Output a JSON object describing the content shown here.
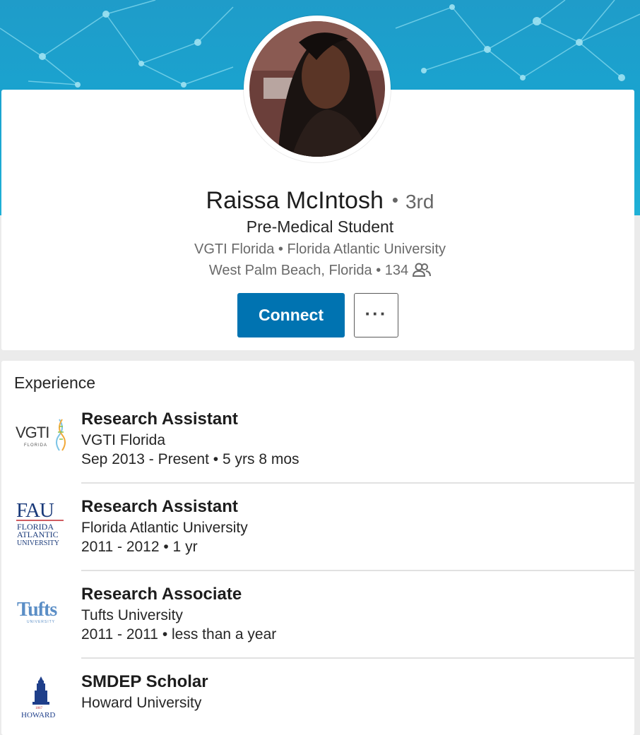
{
  "profile": {
    "name": "Raissa McIntosh",
    "degree": "3rd",
    "headline": "Pre-Medical Student",
    "organizations": "VGTI Florida • Florida Atlantic University",
    "location_connections": "West Palm Beach, Florida • 134",
    "connect_label": "Connect",
    "more_label": "···"
  },
  "experience": {
    "title": "Experience",
    "items": [
      {
        "role": "Research Assistant",
        "org": "VGTI Florida",
        "dates": "Sep 2013 - Present • 5 yrs 8 mos",
        "logo": "vgti-logo"
      },
      {
        "role": "Research Assistant",
        "org": "Florida Atlantic University",
        "dates": "2011 - 2012 • 1 yr",
        "logo": "fau-logo"
      },
      {
        "role": "Research Associate",
        "org": "Tufts University",
        "dates": "2011 - 2011 • less than a year",
        "logo": "tufts-logo"
      },
      {
        "role": "SMDEP Scholar",
        "org": "Howard University",
        "dates": "",
        "logo": "howard-logo"
      }
    ]
  },
  "logos": {
    "vgti": {
      "text": "VGTI",
      "sub": "FLORIDA"
    },
    "fau": {
      "text": "FAU",
      "sub1": "FLORIDA",
      "sub2": "ATLANTIC",
      "sub3": "UNIVERSITY"
    },
    "tufts": {
      "text": "Tufts",
      "sub": "UNIVERSITY"
    },
    "howard": {
      "text": "HOWARD",
      "year": "1867"
    }
  },
  "colors": {
    "accent": "#0073b1",
    "cover": "#1fa6d0",
    "background": "#ebebeb"
  }
}
